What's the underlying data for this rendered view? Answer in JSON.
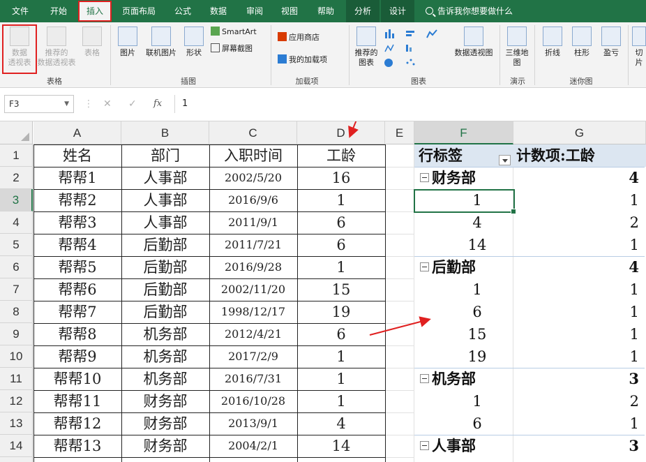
{
  "ribbon_tabs": [
    {
      "label": "文件"
    },
    {
      "label": "开始"
    },
    {
      "label": "插入"
    },
    {
      "label": "页面布局"
    },
    {
      "label": "公式"
    },
    {
      "label": "数据"
    },
    {
      "label": "审阅"
    },
    {
      "label": "视图"
    },
    {
      "label": "帮助"
    },
    {
      "label": "分析"
    },
    {
      "label": "设计"
    }
  ],
  "tell_me": "告诉我你想要做什么",
  "ribbon": {
    "pivot_table": [
      "数据",
      "透视表"
    ],
    "recommended_pivot": [
      "推荐的",
      "数据透视表"
    ],
    "table": "表格",
    "group_tables": "表格",
    "picture": "图片",
    "online_picture": "联机图片",
    "shapes": "形状",
    "smartart": "SmartArt",
    "screenshot": "屏幕截图",
    "group_illustrations": "插图",
    "app_store": "应用商店",
    "my_addins": "我的加载项",
    "group_addins": "加载项",
    "recommended_charts": [
      "推荐的",
      "图表"
    ],
    "pivot_chart": "数据透视图",
    "group_charts": "图表",
    "map3d": [
      "三维地",
      "图"
    ],
    "group_tours": "演示",
    "spark_line": "折线",
    "spark_column": "柱形",
    "spark_winloss": "盈亏",
    "group_sparklines": "迷你图",
    "slicer_partial": "切片"
  },
  "formula_bar": {
    "name_box": "F3",
    "formula": "1"
  },
  "columns": [
    "A",
    "B",
    "C",
    "D",
    "E",
    "F",
    "G"
  ],
  "rows": [
    "1",
    "2",
    "3",
    "4",
    "5",
    "6",
    "7",
    "8",
    "9",
    "10",
    "11",
    "12",
    "13",
    "14"
  ],
  "table": {
    "headers": [
      "姓名",
      "部门",
      "入职时间",
      "工龄"
    ],
    "rows": [
      [
        "帮帮1",
        "人事部",
        "2002/5/20",
        "16"
      ],
      [
        "帮帮2",
        "人事部",
        "2016/9/6",
        "1"
      ],
      [
        "帮帮3",
        "人事部",
        "2011/9/1",
        "6"
      ],
      [
        "帮帮4",
        "后勤部",
        "2011/7/21",
        "6"
      ],
      [
        "帮帮5",
        "后勤部",
        "2016/9/28",
        "1"
      ],
      [
        "帮帮6",
        "后勤部",
        "2002/11/20",
        "15"
      ],
      [
        "帮帮7",
        "后勤部",
        "1998/12/17",
        "19"
      ],
      [
        "帮帮8",
        "机务部",
        "2012/4/21",
        "6"
      ],
      [
        "帮帮9",
        "机务部",
        "2017/2/9",
        "1"
      ],
      [
        "帮帮10",
        "机务部",
        "2016/7/31",
        "1"
      ],
      [
        "帮帮11",
        "财务部",
        "2016/10/28",
        "1"
      ],
      [
        "帮帮12",
        "财务部",
        "2013/9/1",
        "4"
      ],
      [
        "帮帮13",
        "财务部",
        "2004/2/1",
        "14"
      ]
    ]
  },
  "pivot": {
    "row_label": "行标签",
    "value_label": "计数项:工龄",
    "groups": [
      {
        "name": "财务部",
        "total": "4",
        "items": [
          [
            "1",
            "1"
          ],
          [
            "4",
            "2"
          ],
          [
            "14",
            "1"
          ]
        ]
      },
      {
        "name": "后勤部",
        "total": "4",
        "items": [
          [
            "1",
            "1"
          ],
          [
            "6",
            "1"
          ],
          [
            "15",
            "1"
          ],
          [
            "19",
            "1"
          ]
        ]
      },
      {
        "name": "机务部",
        "total": "3",
        "items": [
          [
            "1",
            "2"
          ],
          [
            "6",
            "1"
          ]
        ]
      },
      {
        "name": "人事部",
        "total": "3",
        "items": []
      }
    ]
  },
  "colors": {
    "accent": "#217346",
    "highlight": "#e02020",
    "pivot_header": "#dce6f1"
  }
}
